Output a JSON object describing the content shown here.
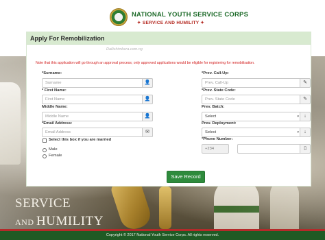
{
  "brand": {
    "title": "NATIONAL YOUTH SERVICE CORPS",
    "motto": "SERVICE AND HUMILITY"
  },
  "panel": {
    "heading": "Apply For Remobilization",
    "watermark": "Dailichimbera.com.ng",
    "note": "Note that this application will go through an approval process; only approved applications would be eligible for registering for remobilisation."
  },
  "form": {
    "surname_label": "*Surname:",
    "surname_placeholder": "Surname",
    "firstname_label": "* First Name:",
    "firstname_placeholder": "First Name",
    "middlename_label": "Middle Name:",
    "middlename_placeholder": "Middle Name",
    "email_label": "*Email Address:",
    "email_placeholder": "Email Address",
    "married_label": "Select this box if you are married",
    "gender_male": "Male",
    "gender_female": "Female",
    "callup_label": "*Prev. Call-Up:",
    "callup_placeholder": "Prev. Call-Up",
    "statecode_label": "*Prev. State Code:",
    "statecode_placeholder": "Prev. State Code",
    "batch_label": "Prev. Batch:",
    "batch_value": "Select",
    "deployment_label": "Prev. Deployment:",
    "deployment_value": "Select",
    "phone_label": "*Phone Number:",
    "phone_prefix": "+234",
    "phone_value": "",
    "save_label": "Save Record"
  },
  "slogan": {
    "line1": "SERVICE",
    "line2_small": "AND ",
    "line2_big": "HUMILITY"
  },
  "footer": {
    "copyright": "Copyright © 2017 National Youth Service Corps. All rights reserved."
  },
  "colors": {
    "brand_green": "#1e6b2a",
    "motto_red": "#b3261e",
    "heading_bg": "#d8ead0",
    "note_red": "#d11a1a",
    "button_green": "#2e8b3c",
    "footer_green": "#1f5a24"
  }
}
